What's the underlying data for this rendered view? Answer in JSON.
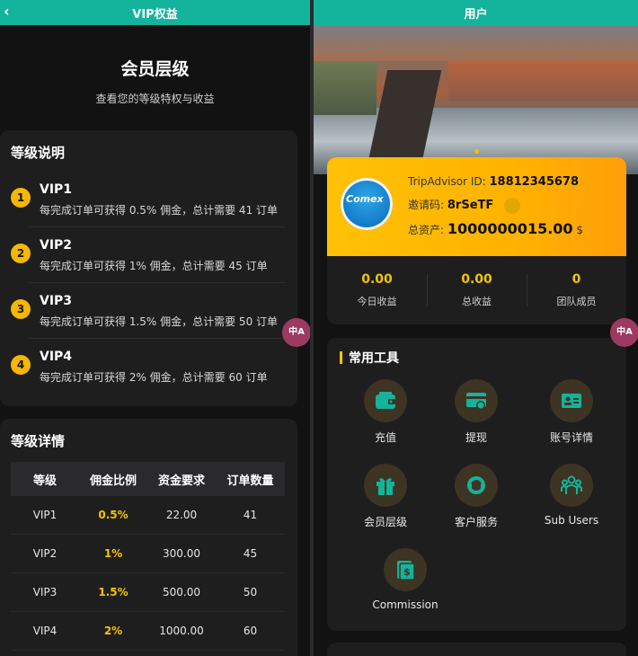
{
  "left": {
    "topbar_title": "VIP权益",
    "back_icon": "chevron-left-icon",
    "hero_title": "会员层级",
    "hero_subtitle": "查看您的等级特权与收益",
    "levels_title": "等级说明",
    "levels": [
      {
        "num": "1",
        "name": "VIP1",
        "desc": "每完成订单可获得 0.5% 佣金，总计需要 41 订单"
      },
      {
        "num": "2",
        "name": "VIP2",
        "desc": "每完成订单可获得 1% 佣金，总计需要 45 订单"
      },
      {
        "num": "3",
        "name": "VIP3",
        "desc": "每完成订单可获得 1.5% 佣金，总计需要 50 订单"
      },
      {
        "num": "4",
        "name": "VIP4",
        "desc": "每完成订单可获得 2% 佣金，总计需要 60 订单"
      }
    ],
    "details_title": "等级详情",
    "table": {
      "headers": [
        "等级",
        "佣金比例",
        "资金要求",
        "订单数量"
      ],
      "rows": [
        [
          "VIP1",
          "0.5%",
          "22.00",
          "41"
        ],
        [
          "VIP2",
          "1%",
          "300.00",
          "45"
        ],
        [
          "VIP3",
          "1.5%",
          "500.00",
          "50"
        ],
        [
          "VIP4",
          "2%",
          "1000.00",
          "60"
        ]
      ]
    },
    "float_button": "中A"
  },
  "right": {
    "topbar_title": "用户",
    "user": {
      "logo_text": "Comex",
      "id_label": "TripAdvisor ID:",
      "id_value": "18812345678",
      "invite_label": "邀请码:",
      "invite_value": "8rSeTF",
      "assets_label": "总资产:",
      "assets_value": "1000000015.00",
      "assets_unit": "$"
    },
    "stats": [
      {
        "value": "0.00",
        "label": "今日收益"
      },
      {
        "value": "0.00",
        "label": "总收益"
      },
      {
        "value": "0",
        "label": "团队成员"
      }
    ],
    "tools_title": "常用工具",
    "tools": [
      {
        "label": "充值",
        "icon": "wallet-icon"
      },
      {
        "label": "提现",
        "icon": "card-withdraw-icon"
      },
      {
        "label": "账号详情",
        "icon": "id-card-icon"
      },
      {
        "label": "会员层级",
        "icon": "gift-icon"
      },
      {
        "label": "客户服务",
        "icon": "headset-icon"
      },
      {
        "label": "Sub Users",
        "icon": "users-group-icon"
      },
      {
        "label": "Commission",
        "icon": "commission-doc-icon"
      }
    ],
    "float_button": "中A",
    "colors": {
      "accent": "#14b39b",
      "gold": "#f5c400",
      "card": "#1e1e1f"
    }
  }
}
